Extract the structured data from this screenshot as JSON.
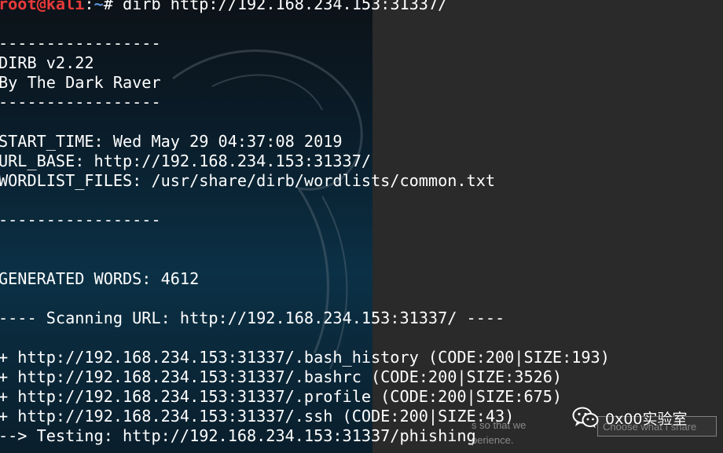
{
  "prompt": {
    "user_host": "root@kali",
    "path_sep": ":",
    "path": "~",
    "symbol": "# ",
    "command": "dirb http://192.168.234.153:31337/"
  },
  "output": {
    "sep1": "-----------------",
    "dirb_version": "DIRB v2.22",
    "author": "By The Dark Raver",
    "sep2": "-----------------",
    "start_time": "START_TIME: Wed May 29 04:37:08 2019",
    "url_base": "URL_BASE: http://192.168.234.153:31337/",
    "wordlist": "WORDLIST_FILES: /usr/share/dirb/wordlists/common.txt",
    "sep3": "-----------------",
    "generated_words": "GENERATED WORDS: 4612",
    "scanning": "---- Scanning URL: http://192.168.234.153:31337/ ----",
    "results": [
      "+ http://192.168.234.153:31337/.bash_history (CODE:200|SIZE:193)",
      "+ http://192.168.234.153:31337/.bashrc (CODE:200|SIZE:3526)",
      "+ http://192.168.234.153:31337/.profile (CODE:200|SIZE:675)",
      "+ http://192.168.234.153:31337/.ssh (CODE:200|SIZE:43)"
    ],
    "testing": "--> Testing: http://192.168.234.153:31337/phishing"
  },
  "overlay": {
    "cookie_line1": "s so that we",
    "cookie_line2": "perience.",
    "choose_button": "Choose what I share",
    "watermark_text": "0x00实验室"
  },
  "colors": {
    "prompt_user": "#e83a3a",
    "prompt_path": "#5a93d6",
    "text": "#ffffff",
    "overlay_bg": "#2a2a2a"
  }
}
